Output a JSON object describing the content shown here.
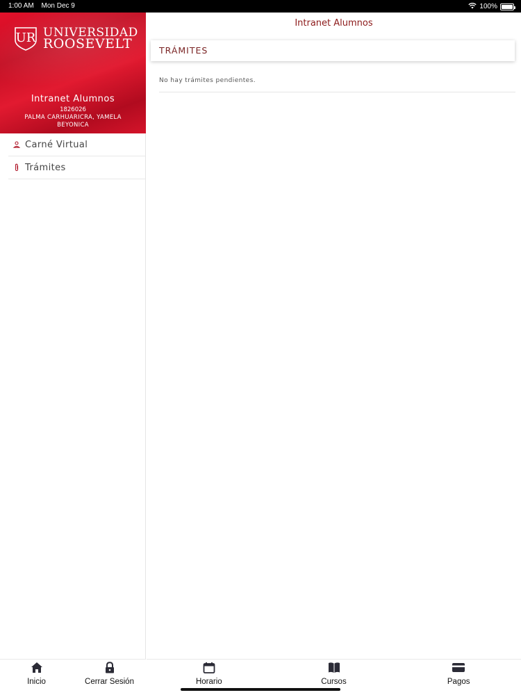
{
  "status_bar": {
    "time": "1:00 AM",
    "date": "Mon Dec 9",
    "battery": "100%"
  },
  "sidebar": {
    "logo": {
      "line1": "UNIVERSIDAD",
      "line2": "ROOSEVELT",
      "mark": "UR"
    },
    "title": "Intranet Alumnos",
    "student_code": "1826026",
    "student_name": "PALMA CARHUARICRA, YAMELA BEYONICA",
    "items": [
      {
        "label": "Carné Virtual",
        "icon": "person-icon"
      },
      {
        "label": "Trámites",
        "icon": "paperclip-icon"
      }
    ],
    "tabs": [
      {
        "label": "Inicio",
        "icon": "home-icon"
      },
      {
        "label": "Cerrar Sesión",
        "icon": "lock-icon"
      }
    ]
  },
  "main": {
    "title": "Intranet Alumnos",
    "section_title": "TRÁMITES",
    "empty_message": "No hay trámites pendientes.",
    "tabs": [
      {
        "label": "Horario",
        "icon": "calendar-icon"
      },
      {
        "label": "Cursos",
        "icon": "book-icon"
      },
      {
        "label": "Pagos",
        "icon": "credit-card-icon"
      }
    ]
  },
  "colors": {
    "brand_red": "#d3122a",
    "title_red": "#8c1a1a",
    "section_red": "#7a2424"
  }
}
